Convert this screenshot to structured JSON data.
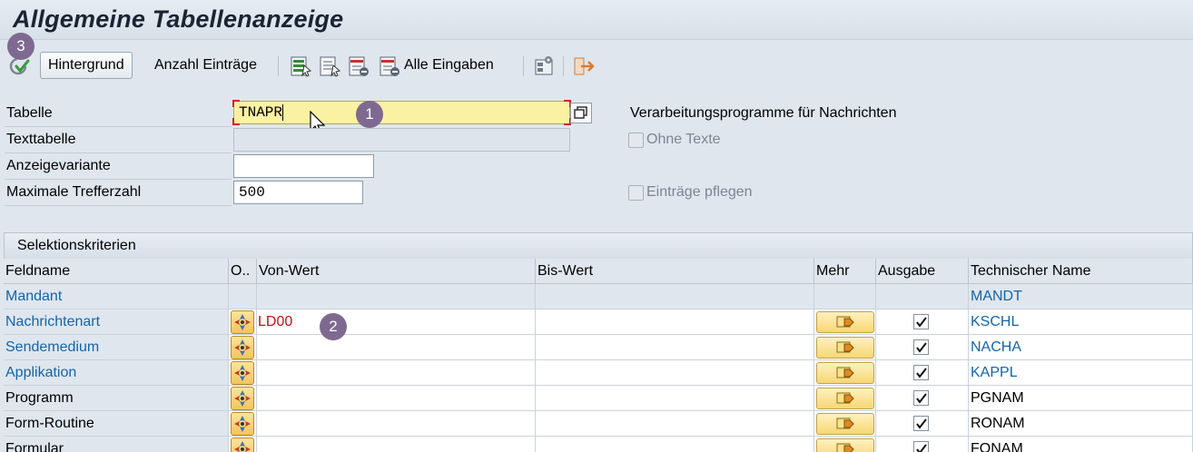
{
  "title": "Allgemeine Tabellenanzeige",
  "toolbar": {
    "execute_icon": "execute-check-icon",
    "background_label": "Hintergrund",
    "count_label": "Anzahl Einträge",
    "all_entries_label": "Alle Eingaben"
  },
  "form": {
    "table_label": "Tabelle",
    "table_value": "TNAPR",
    "table_description": "Verarbeitungsprogramme für Nachrichten",
    "texttable_label": "Texttabelle",
    "texttable_value": "",
    "variant_label": "Anzeigevariante",
    "variant_value": "",
    "max_hits_label": "Maximale Trefferzahl",
    "max_hits_value": "500",
    "no_texts_label": "Ohne Texte",
    "maintain_label": "Einträge pflegen"
  },
  "badges": [
    "1",
    "2",
    "3"
  ],
  "selection": {
    "title": "Selektionskriterien",
    "columns": [
      "Feldname",
      "O..",
      "Von-Wert",
      "Bis-Wert",
      "Mehr",
      "Ausgabe",
      "Technischer Name"
    ],
    "rows": [
      {
        "field": "Mandant",
        "from": "",
        "to": "",
        "tech": "MANDT",
        "link": true,
        "editable": false,
        "output": false
      },
      {
        "field": "Nachrichtenart",
        "from": "LD00",
        "to": "",
        "tech": "KSCHL",
        "link": true,
        "editable": true,
        "output": true
      },
      {
        "field": "Sendemedium",
        "from": "",
        "to": "",
        "tech": "NACHA",
        "link": true,
        "editable": true,
        "output": true
      },
      {
        "field": "Applikation",
        "from": "",
        "to": "",
        "tech": "KAPPL",
        "link": true,
        "editable": true,
        "output": true
      },
      {
        "field": "Programm",
        "from": "",
        "to": "",
        "tech": "PGNAM",
        "link": false,
        "editable": true,
        "output": true
      },
      {
        "field": "Form-Routine",
        "from": "",
        "to": "",
        "tech": "RONAM",
        "link": false,
        "editable": true,
        "output": true
      },
      {
        "field": "Formular",
        "from": "",
        "to": "",
        "tech": "FONAM",
        "link": false,
        "editable": true,
        "output": true
      }
    ]
  },
  "colors": {
    "link": "#1464a5",
    "value_red": "#b5121b",
    "badge": "#7e6a90",
    "focus_field": "#fbf1a3"
  }
}
